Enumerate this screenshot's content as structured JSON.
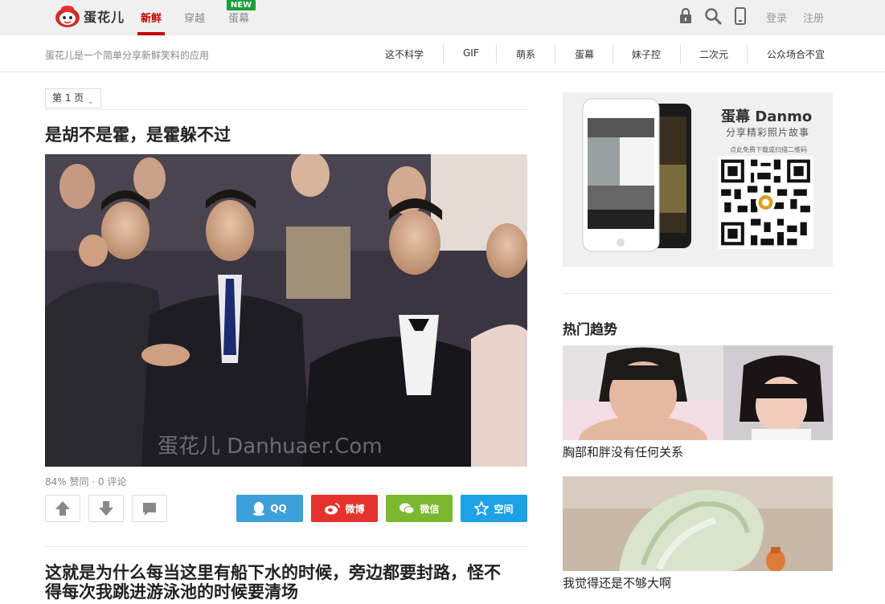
{
  "header": {
    "brand": "蛋花儿",
    "tabs": [
      {
        "label": "新鲜",
        "active": true
      },
      {
        "label": "穿越",
        "active": false
      },
      {
        "label": "蛋幕",
        "active": false
      }
    ],
    "new_badge": "NEW",
    "icons": [
      "lock-icon",
      "search-icon",
      "mobile-icon"
    ],
    "login": "登录",
    "register": "注册",
    "accent_color": "#c40000"
  },
  "subheader": {
    "tagline": "蛋花儿是一个简单分享新鲜笑料的应用",
    "categories": [
      "这不科学",
      "GIF",
      "萌系",
      "蛋幕",
      "妹子控",
      "二次元",
      "公众场合不宜"
    ]
  },
  "pager": {
    "label": "第 1 页"
  },
  "posts": [
    {
      "title": "是胡不是霍，是霍躲不过",
      "watermark": "蛋花儿 Danhuaer.Com",
      "meta": "84% 赞同 · 0 评论",
      "share": [
        {
          "label": "QQ",
          "color": "#3ea0d8",
          "icon": "qq-icon"
        },
        {
          "label": "微博",
          "color": "#e5322d",
          "icon": "weibo-icon"
        },
        {
          "label": "微信",
          "color": "#7cb82f",
          "icon": "wechat-icon"
        },
        {
          "label": "空间",
          "color": "#1da1e7",
          "icon": "star-icon"
        }
      ]
    },
    {
      "title_line1": "这就是为什么每当这里有船下水的时候，旁边都要封路，怪不",
      "title_line2": "得每次我跳进游泳池的时候要清场"
    }
  ],
  "sidebar": {
    "promo": {
      "title": "蛋幕 Danmo",
      "subtitle": "分享精彩照片故事",
      "tip": "点此免费下载或扫描二维码"
    },
    "trending_heading": "热门趋势",
    "trending": [
      {
        "caption": "胸部和胖没有任何关系"
      },
      {
        "caption": "我觉得还是不够大啊"
      }
    ]
  }
}
